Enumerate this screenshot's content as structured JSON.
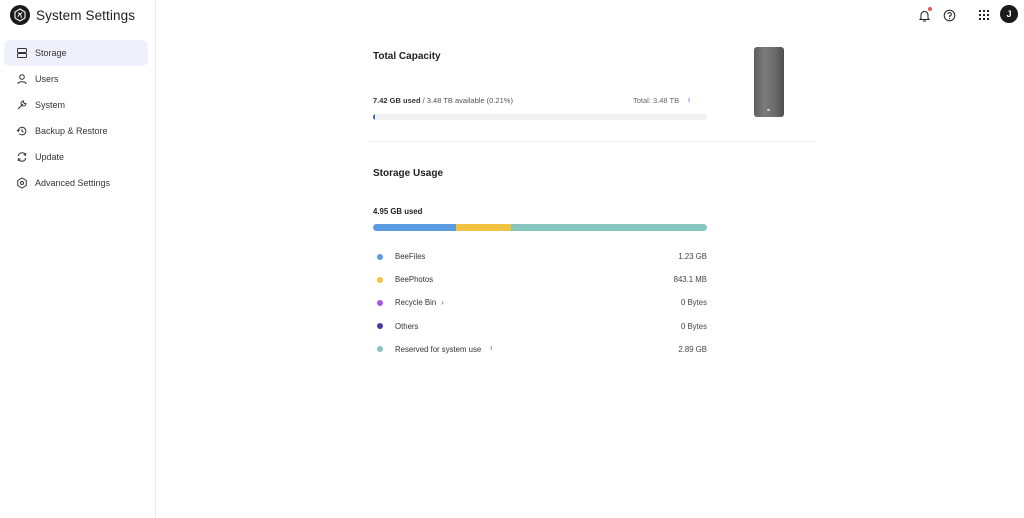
{
  "app": {
    "title": "System Settings"
  },
  "sidebar": {
    "items": [
      {
        "label": "Storage",
        "icon": "storage-icon",
        "active": true
      },
      {
        "label": "Users",
        "icon": "user-icon",
        "active": false
      },
      {
        "label": "System",
        "icon": "wrench-icon",
        "active": false
      },
      {
        "label": "Backup & Restore",
        "icon": "backup-icon",
        "active": false
      },
      {
        "label": "Update",
        "icon": "refresh-icon",
        "active": false
      },
      {
        "label": "Advanced Settings",
        "icon": "advanced-gear-icon",
        "active": false
      }
    ]
  },
  "topbar": {
    "notification_icon": "bell-icon",
    "help_icon": "help-icon",
    "apps_icon": "apps-grid-icon",
    "avatar_initial": "J"
  },
  "capacity": {
    "title": "Total Capacity",
    "used_label": "7.42 GB used",
    "available_label": " / 3.48 TB available (0.21%)",
    "total_label": "Total: 3.48 TB",
    "used_fraction": 0.0021,
    "accent": "#2f5fd0"
  },
  "usage": {
    "title": "Storage Usage",
    "used_label": "4.95 GB used",
    "categories": [
      {
        "name": "BeeFiles",
        "value": "1.23 GB",
        "color": "#5b9be0",
        "fraction": 0.248
      },
      {
        "name": "BeePhotos",
        "value": "843.1 MB",
        "color": "#f0c440",
        "fraction": 0.166
      },
      {
        "name": "Recycle Bin",
        "value": "0 Bytes",
        "color": "#a259e6",
        "fraction": 0
      },
      {
        "name": "Others",
        "value": "0 Bytes",
        "color": "#4a3aa8",
        "fraction": 0
      },
      {
        "name": "Reserved for system use",
        "value": "2.89 GB",
        "color": "#86c6bf",
        "fraction": 0.586
      }
    ]
  }
}
